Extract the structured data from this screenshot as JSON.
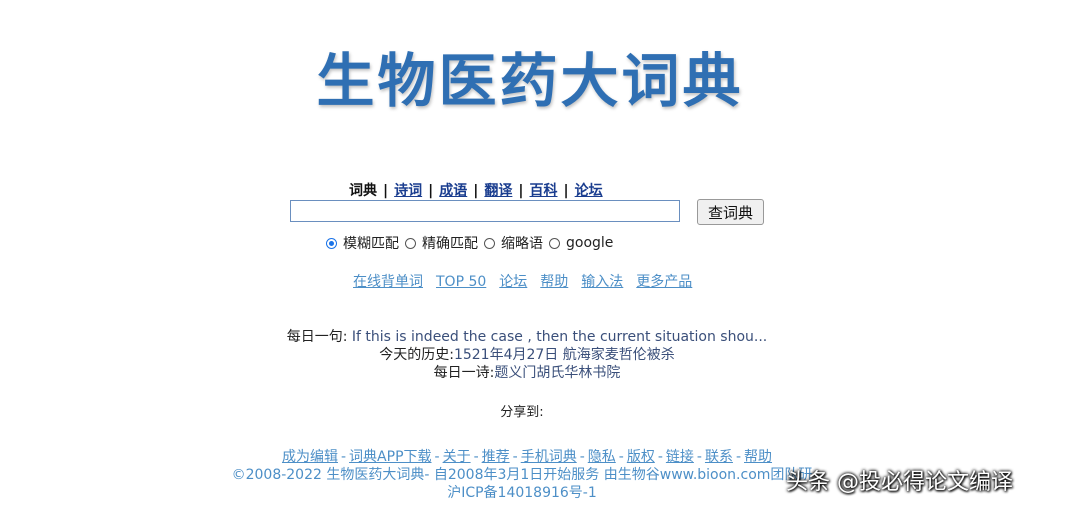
{
  "logo": {
    "title": "生物医药大词典"
  },
  "tabs": [
    {
      "label": "词典",
      "active": true
    },
    {
      "label": "诗词",
      "active": false
    },
    {
      "label": "成语",
      "active": false
    },
    {
      "label": "翻译",
      "active": false
    },
    {
      "label": "百科",
      "active": false
    },
    {
      "label": "论坛",
      "active": false
    }
  ],
  "search": {
    "value": "",
    "button_label": "查词典"
  },
  "match_options": [
    {
      "label": "模糊匹配",
      "checked": true
    },
    {
      "label": "精确匹配",
      "checked": false
    },
    {
      "label": "缩略语",
      "checked": false
    },
    {
      "label": "google",
      "checked": false
    }
  ],
  "quick_links": [
    "在线背单词",
    "TOP 50",
    "论坛",
    "帮助",
    "输入法",
    "更多产品"
  ],
  "daily": {
    "sentence_label": "每日一句:",
    "sentence": "If this is indeed the case , then the current situation shou...",
    "history_label": "今天的历史:",
    "history": "1521年4月27日 航海家麦哲伦被杀",
    "poem_label": "每日一诗:",
    "poem": "题义门胡氏华林书院"
  },
  "share": {
    "label": "分享到:"
  },
  "footer": {
    "links": [
      "成为编辑",
      "词典APP下载",
      "关于",
      "推荐",
      "手机词典",
      "隐私",
      "版权",
      "链接",
      "联系",
      "帮助"
    ],
    "copyright": "©2008-2022 生物医药大词典- 自2008年3月1日开始服务 由生物谷www.bioon.com团队研",
    "icp": "沪ICP备14018916号-1"
  },
  "watermark": {
    "text": "头条 @投必得论文编译"
  },
  "colors": {
    "logo": "#2f6fb3",
    "link": "#4d8fc7",
    "tab_link": "#1a3d8f"
  }
}
